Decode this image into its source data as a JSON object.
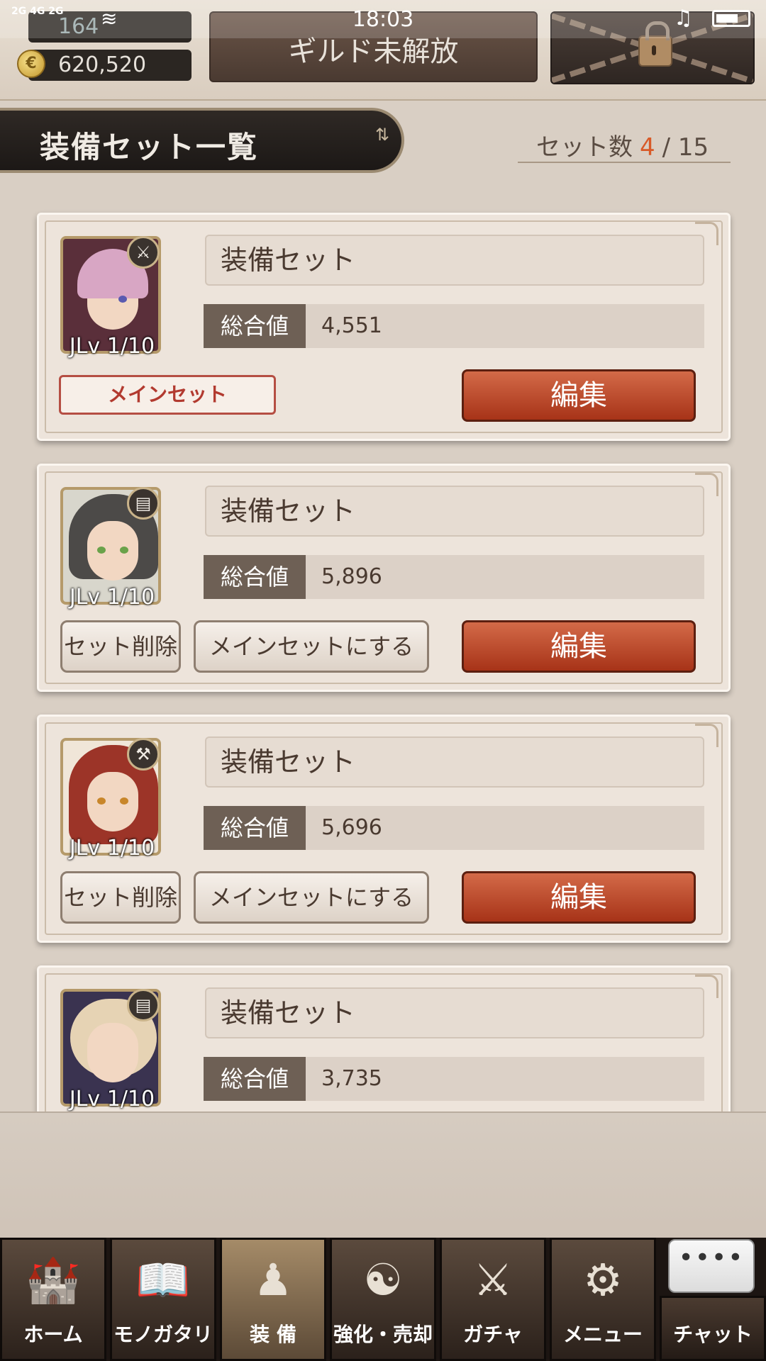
{
  "status_bar": {
    "network": "2G 4G\n2G",
    "time": "18:03",
    "wifi_icon": "wifi-icon",
    "bell_icon": "bell-muted-icon",
    "battery_icon": "battery-icon"
  },
  "header": {
    "stamina_value": "164",
    "coins_value": "620,520",
    "coin_symbol": "€",
    "guild_text": "ギルド未解放",
    "lock_icon": "padlock-icon"
  },
  "page": {
    "title": "装備セット一覧",
    "sort_icon_glyph": "⇅",
    "set_count_label": "セット数",
    "set_count_current": "4",
    "set_count_sep": "/",
    "set_count_max": "15"
  },
  "sets": [
    {
      "name": "装備セット",
      "total_label": "総合値",
      "total_value": "4,551",
      "level": "JLv 1/10",
      "weapon_icon": "sword-icon",
      "weapon_glyph": "⚔",
      "is_main": true,
      "main_badge": "メインセット",
      "edit_label": "編集",
      "hair_color": "#d8a6c4"
    },
    {
      "name": "装備セット",
      "total_label": "総合値",
      "total_value": "5,896",
      "level": "JLv 1/10",
      "weapon_icon": "tome-icon",
      "weapon_glyph": "▤",
      "is_main": false,
      "delete_label": "セット削除",
      "make_main_label": "メインセットにする",
      "edit_label": "編集",
      "hair_color": "#4c4a48"
    },
    {
      "name": "装備セット",
      "total_label": "総合値",
      "total_value": "5,696",
      "level": "JLv 1/10",
      "weapon_icon": "hammer-icon",
      "weapon_glyph": "⚒",
      "is_main": false,
      "delete_label": "セット削除",
      "make_main_label": "メインセットにする",
      "edit_label": "編集",
      "hair_color": "#9c3428"
    },
    {
      "name": "装備セット",
      "total_label": "総合値",
      "total_value": "3,735",
      "level": "JLv 1/10",
      "weapon_icon": "tome-icon",
      "weapon_glyph": "▤",
      "is_main": false,
      "hair_color": "#3a2d4a"
    }
  ],
  "nav": [
    {
      "label": "ホーム",
      "icon": "castle-icon",
      "glyph": "🏰",
      "active": false
    },
    {
      "label": "モノガタリ",
      "icon": "book-icon",
      "glyph": "📖",
      "active": false
    },
    {
      "label": "装 備",
      "icon": "puppet-icon",
      "glyph": "♟",
      "active": true
    },
    {
      "label": "強化・売却",
      "icon": "mask-icon",
      "glyph": "☯",
      "active": false
    },
    {
      "label": "ガチャ",
      "icon": "crossed-swords-icon",
      "glyph": "⚔",
      "active": false
    },
    {
      "label": "メニュー",
      "icon": "gear-icon",
      "glyph": "⚙",
      "active": false
    }
  ],
  "chat": {
    "label": "チャット",
    "bubble_text": "••••",
    "icon": "chat-bubble-icon"
  }
}
